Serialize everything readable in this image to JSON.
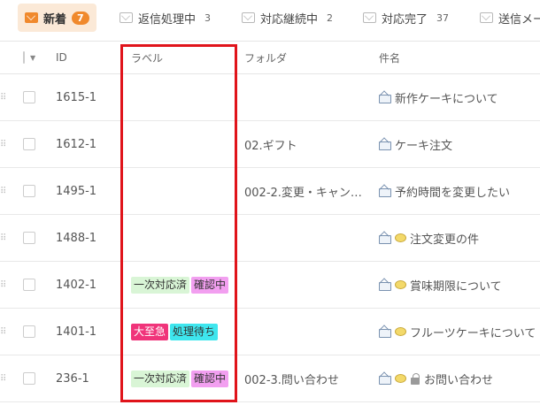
{
  "tabs": [
    {
      "label": "新着",
      "count": "7",
      "active": true
    },
    {
      "label": "返信処理中",
      "count": "3"
    },
    {
      "label": "対応継続中",
      "count": "2"
    },
    {
      "label": "対応完了",
      "count": "37"
    },
    {
      "label": "送信メー",
      "count": ""
    }
  ],
  "columns": {
    "id": "ID",
    "label": "ラベル",
    "folder": "フォルダ",
    "subject": "件名"
  },
  "rows": [
    {
      "id": "1615-1",
      "folder": "",
      "subject": "新作ケーキについて",
      "labels": []
    },
    {
      "id": "1612-1",
      "folder": "02.ギフト",
      "subject": "ケーキ注文",
      "labels": []
    },
    {
      "id": "1495-1",
      "folder": "002-2.変更・キャン…",
      "subject": "予約時間を変更したい",
      "labels": []
    },
    {
      "id": "1488-1",
      "folder": "",
      "subject": "注文変更の件",
      "labels": []
    },
    {
      "id": "1402-1",
      "folder": "",
      "subject": "賞味期限について",
      "labels": [
        {
          "text": "一次対応済",
          "bg": "#d9f5d6",
          "fg": "#333"
        },
        {
          "text": "確認中",
          "bg": "#f29ff0",
          "fg": "#333"
        }
      ]
    },
    {
      "id": "1401-1",
      "folder": "",
      "subject": "フルーツケーキについて",
      "labels": [
        {
          "text": "大至急",
          "bg": "#f0347a",
          "fg": "#ffffff"
        },
        {
          "text": "処理待ち",
          "bg": "#3ee6ee",
          "fg": "#333"
        }
      ]
    },
    {
      "id": "236-1",
      "folder": "002-3.問い合わせ",
      "subject": "お問い合わせ",
      "labels": [
        {
          "text": "一次対応済",
          "bg": "#d9f5d6",
          "fg": "#333"
        },
        {
          "text": "確認中",
          "bg": "#f29ff0",
          "fg": "#333"
        }
      ]
    }
  ],
  "colors": {
    "accent": "#f0892c",
    "highlight": "#e0141b"
  }
}
